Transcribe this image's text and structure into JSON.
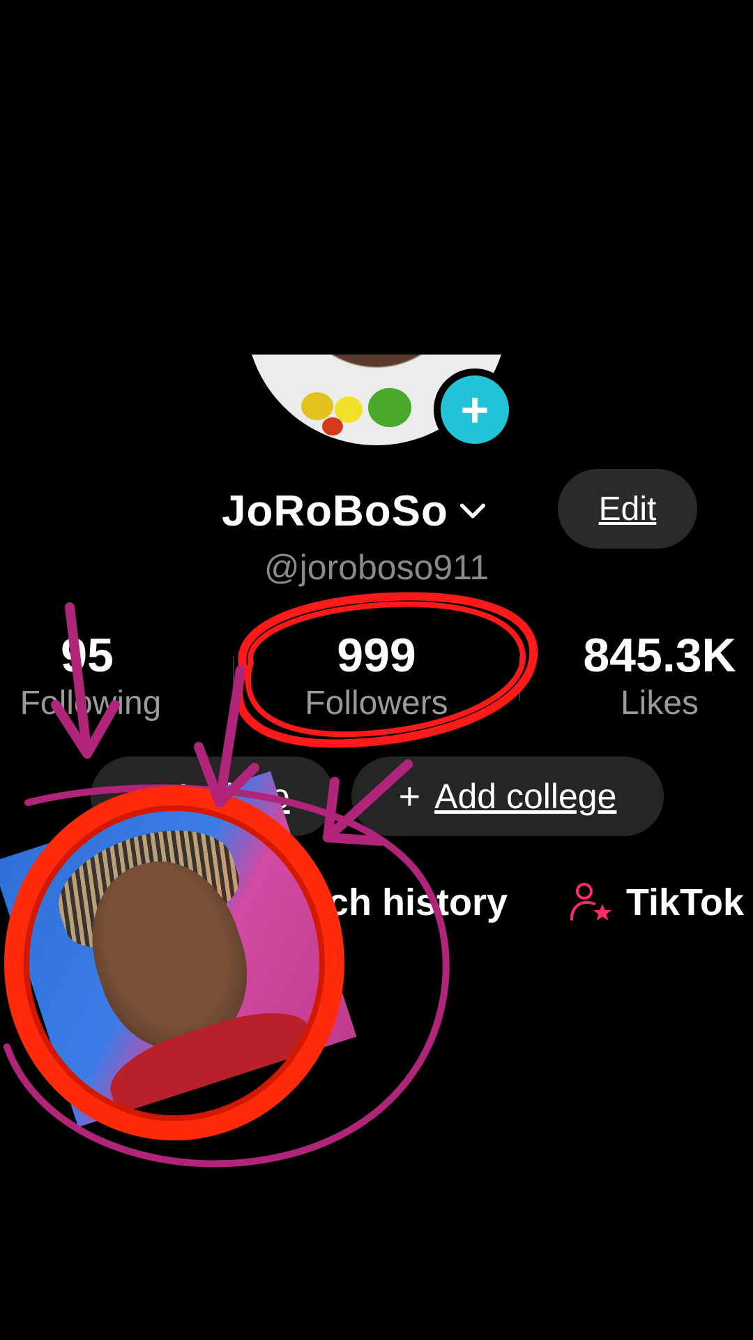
{
  "profile": {
    "display_name": "JoRoBoSo",
    "username": "@joroboso911",
    "edit_label": "Edit"
  },
  "stats": {
    "following": {
      "value": "95",
      "label": "Following"
    },
    "followers": {
      "value": "999",
      "label": "Followers"
    },
    "likes": {
      "value": "845.3K",
      "label": "Likes"
    }
  },
  "actions": {
    "add_bio_label": "Add bio",
    "add_college_label": "Add college",
    "plus_glyph": "+"
  },
  "links": {
    "watch_history": "ch history",
    "tiktok_studio": "TikTok"
  },
  "icons": {
    "add_avatar": "plus-icon",
    "name_dropdown": "chevron-down-icon",
    "studio": "person-star-icon"
  },
  "colors": {
    "background": "#000000",
    "accent_cyan": "#22c4d8",
    "pill_bg": "#252525",
    "studio_pink": "#ff2a6a",
    "annotation_red": "#ff1a1a",
    "annotation_magenta": "#b0247a"
  }
}
